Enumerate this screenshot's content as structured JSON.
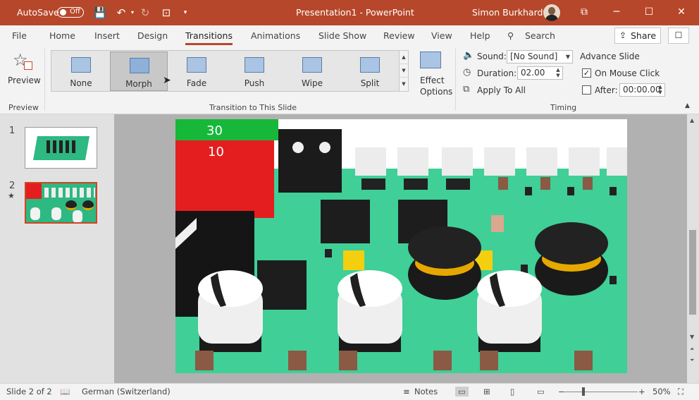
{
  "titlebar": {
    "autosave_label": "AutoSave",
    "autosave_state": "Off",
    "document_title": "Presentation1  -  PowerPoint",
    "user_name": "Simon Burkhardt",
    "accent_color": "#b7472a"
  },
  "tabs": [
    "File",
    "Home",
    "Insert",
    "Design",
    "Transitions",
    "Animations",
    "Slide Show",
    "Review",
    "View",
    "Help"
  ],
  "active_tab": "Transitions",
  "search_label": "Search",
  "share_label": "Share",
  "ribbon": {
    "preview": {
      "label": "Preview",
      "group_label": "Preview"
    },
    "gallery": {
      "items": [
        "None",
        "Morph",
        "Fade",
        "Push",
        "Wipe",
        "Split"
      ],
      "selected": "Morph",
      "group_label": "Transition to This Slide"
    },
    "effect_options": {
      "line1": "Effect",
      "line2": "Options"
    },
    "timing": {
      "sound_label": "Sound:",
      "sound_value": "[No Sound]",
      "duration_label": "Duration:",
      "duration_value": "02.00",
      "apply_to_all_label": "Apply To All",
      "advance_slide_label": "Advance Slide",
      "on_mouse_click_label": "On Mouse Click",
      "on_mouse_click_checked": true,
      "after_label": "After:",
      "after_value": "00:00.00",
      "after_checked": false,
      "group_label": "Timing"
    }
  },
  "slides": [
    {
      "number": "1",
      "marker": ""
    },
    {
      "number": "2",
      "marker": "★"
    }
  ],
  "slide_content": {
    "fuse_30": "30",
    "fuse_10": "10"
  },
  "status": {
    "slide_indicator": "Slide 2 of 2",
    "language": "German (Switzerland)",
    "notes_label": "Notes",
    "zoom": "50%"
  }
}
